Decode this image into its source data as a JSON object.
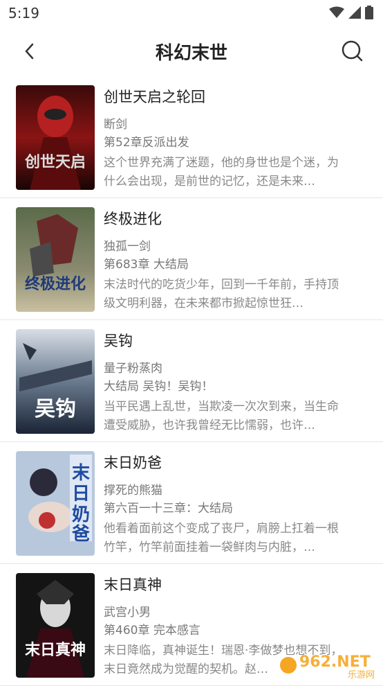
{
  "status": {
    "time": "5:19"
  },
  "header": {
    "title": "科幻末世"
  },
  "books": [
    {
      "title": "创世天启之轮回",
      "author": "断剑",
      "chapter": "第52章反派出发",
      "desc": "这个世界充满了迷题，他的身世也是个迷，为什么会出现，是前世的记忆，还是未来…",
      "cover_text": "创世天启"
    },
    {
      "title": "终极进化",
      "author": "独孤一剑",
      "chapter": "第683章 大结局",
      "desc": "末法时代的吃货少年，回到一千年前，手持顶级文明利器，在未来都市掀起惊世狂…",
      "cover_text": "终极进化"
    },
    {
      "title": "吴钩",
      "author": "量子粉蒸肉",
      "chapter": "大结局 吴钩！吴钩！",
      "desc": "当平民遇上乱世，当欺凌一次次到来，当生命遭受威胁，也许我曾经无比懦弱，也许…",
      "cover_text": "吴钩"
    },
    {
      "title": "末日奶爸",
      "author": "撑死的熊猫",
      "chapter": "第六百一十三章：大结局",
      "desc": "他看着面前这个变成了丧尸，肩膀上扛着一根竹竿，竹竿前面挂着一袋鲜肉与内脏，…",
      "cover_text": "末日奶爸"
    },
    {
      "title": "末日真神",
      "author": "武宫小男",
      "chapter": "第460章 完本感言",
      "desc": "末日降临，真神诞生！瑞恩·李做梦也想不到，末日竟然成为觉醒的契机。赵…",
      "cover_text": "末日真神"
    }
  ],
  "watermark": {
    "text": "962.NET",
    "sub": "乐游网"
  }
}
